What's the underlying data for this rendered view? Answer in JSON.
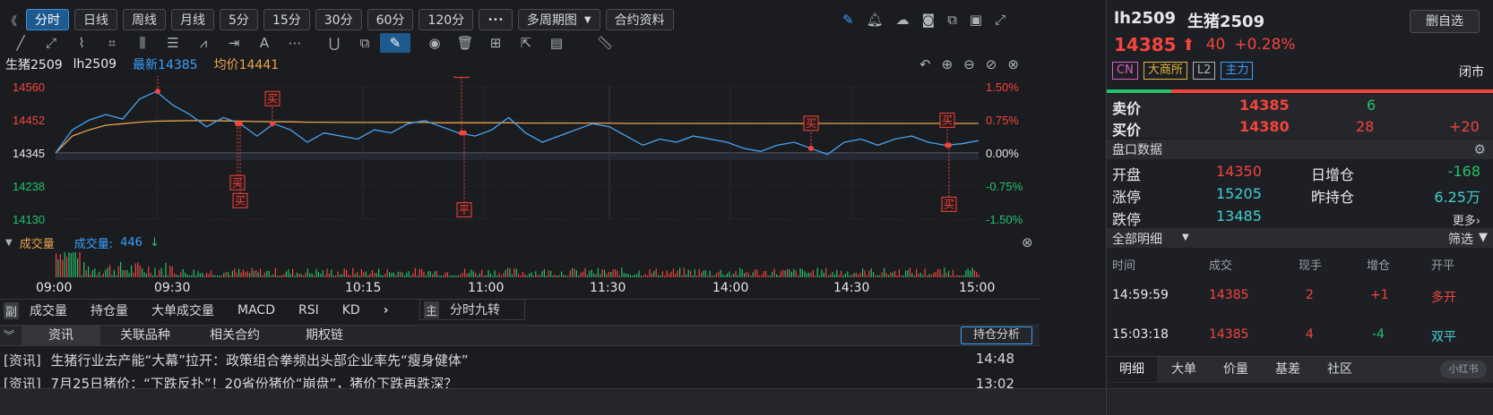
{
  "toolbar": {
    "collapse": "《",
    "buttons": [
      "分时",
      "日线",
      "周线",
      "月线",
      "5分",
      "15分",
      "30分",
      "60分",
      "120分"
    ],
    "more": "•••",
    "multi": "多周期图",
    "contract": "合约资料"
  },
  "chart_header": {
    "name": "生猪2509",
    "code": "lh2509",
    "latest": "最新14385",
    "avg": "均价14441"
  },
  "price_axis": [
    "14560",
    "14452",
    "14345",
    "14238",
    "14130"
  ],
  "pct_axis": [
    "1.50%",
    "0.75%",
    "0.00%",
    "-0.75%",
    "-1.50%"
  ],
  "markers": [
    "平",
    "买",
    "买",
    "买",
    "平",
    "平",
    "买",
    "买",
    "买"
  ],
  "volume": {
    "title": "成交量",
    "label": "成交量:",
    "value": "446"
  },
  "time_axis": [
    "09:00",
    "09:30",
    "10:15",
    "11:00",
    "11:30",
    "14:00",
    "14:30",
    "15:00"
  ],
  "indicator_tabs": {
    "prefix": "副",
    "tabs": [
      "成交量",
      "持仓量",
      "大单成交量",
      "MACD",
      "RSI",
      "KD"
    ],
    "main_prefix": "主",
    "main": "分时九转"
  },
  "info_tabs": {
    "tabs": [
      "资讯",
      "关联品种",
      "相关合约",
      "期权链"
    ],
    "analysis": "持仓分析"
  },
  "news": [
    {
      "tag": "[资讯]",
      "title": "生猪行业去产能“大幕”拉开：政策组合拳频出头部企业率先“瘦身健体”",
      "time": "14:48"
    },
    {
      "tag": "[资讯]",
      "title": "7月25日猪价：“下跌反扑”！20省份猪价“崩盘”，猪价下跌再跌深？",
      "time": "13:02"
    }
  ],
  "quote": {
    "code": "lh2509",
    "name": "生猪2509",
    "remove": "删自选",
    "price": "14385",
    "change": "40",
    "pct": "+0.28%",
    "tags": [
      "CN",
      "大商所",
      "L2",
      "主力"
    ],
    "status": "闭市"
  },
  "order_book": {
    "sell": {
      "label": "卖价",
      "price": "14385",
      "vol": "6",
      "chg": ""
    },
    "buy": {
      "label": "买价",
      "price": "14380",
      "vol": "28",
      "chg": "+20"
    }
  },
  "panel": {
    "title": "盘口数据",
    "rows": [
      {
        "l1": "开盘",
        "v1": "14350",
        "l2": "日增仓",
        "v2": "-168"
      },
      {
        "l1": "涨停",
        "v1": "15205",
        "l2": "昨持仓",
        "v2": "6.25万"
      },
      {
        "l1": "跌停",
        "v1": "13485",
        "l2": "",
        "v2": ""
      }
    ],
    "more": "更多›"
  },
  "detail": {
    "title": "全部明细",
    "filter": "筛选",
    "headers": [
      "时间",
      "成交",
      "现手",
      "增仓",
      "开平"
    ],
    "rows": [
      {
        "time": "14:59:59",
        "price": "14385",
        "vol": "2",
        "chg": "+1",
        "type": "多开"
      },
      {
        "time": "15:03:18",
        "price": "14385",
        "vol": "4",
        "chg": "-4",
        "type": "双平"
      }
    ]
  },
  "bottom_tabs": [
    "明细",
    "大单",
    "价量",
    "基差",
    "社区"
  ],
  "watermark": "小红书",
  "chart_data": {
    "type": "line",
    "x_ticks": [
      "09:00",
      "09:30",
      "10:15",
      "11:00",
      "11:30",
      "14:00",
      "14:30",
      "15:00"
    ],
    "ylim": [
      14130,
      14560
    ],
    "y_ticks": [
      14560,
      14452,
      14345,
      14238,
      14130
    ],
    "series": [
      {
        "values": [
          14345,
          14420,
          14452,
          14470,
          14455,
          14520,
          14545,
          14500,
          14470,
          14430,
          14460,
          14440,
          14400,
          14440,
          14420,
          14380,
          14410,
          14400,
          14390,
          14420,
          14410,
          14440,
          14450,
          14430,
          14410,
          14400,
          14420,
          14460,
          14410,
          14380,
          14400,
          14420,
          14440,
          14430,
          14400,
          14370,
          14390,
          14380,
          14400,
          14390,
          14380,
          14360,
          14350,
          14370,
          14380,
          14360,
          14340,
          14380,
          14390,
          14370,
          14390,
          14400,
          14380,
          14370,
          14375,
          14385
        ]
      },
      {
        "values": [
          14345,
          14400,
          14420,
          14435,
          14440,
          14445,
          14448,
          14449,
          14450,
          14450,
          14449,
          14448,
          14447,
          14446,
          14446,
          14445,
          14445,
          14444,
          14444,
          14444,
          14444,
          14444,
          14444,
          14443,
          14443,
          14443,
          14443,
          14443,
          14442,
          14442,
          14442,
          14442,
          14442,
          14442,
          14441,
          14441,
          14441,
          14441,
          14441,
          14441,
          14441,
          14441,
          14441,
          14441,
          14441,
          14441,
          14441,
          14441,
          14441,
          14441,
          14441,
          14441,
          14441,
          14441,
          14441,
          14441
        ]
      }
    ]
  }
}
